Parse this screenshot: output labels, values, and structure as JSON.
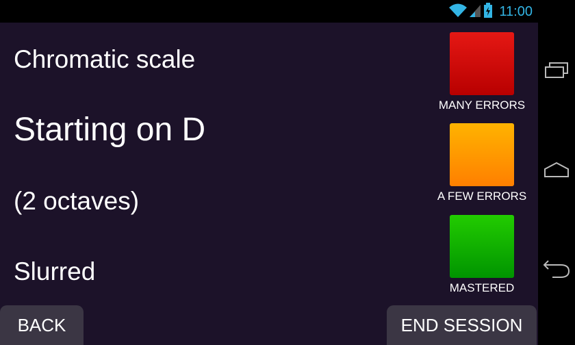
{
  "status_bar": {
    "time": "11:00",
    "icons": [
      "wifi-icon",
      "signal-icon",
      "battery-charging-icon"
    ]
  },
  "exercise": {
    "line1": "Chromatic scale",
    "line2": "Starting on D",
    "line3": "(2 octaves)",
    "line4": "Slurred"
  },
  "ratings": {
    "many_errors": {
      "label": "MANY ERRORS",
      "color": "#d50a0a"
    },
    "few_errors": {
      "label": "A FEW ERRORS",
      "color": "#ff9900"
    },
    "mastered": {
      "label": "MASTERED",
      "color": "#13b300"
    }
  },
  "buttons": {
    "back": "BACK",
    "end_session": "END SESSION"
  },
  "nav_bar": {
    "icons": [
      "recent-apps-icon",
      "home-icon",
      "back-icon"
    ]
  },
  "colors": {
    "background": "#1c1229",
    "button": "#3b3644",
    "accent": "#33b5e5"
  }
}
